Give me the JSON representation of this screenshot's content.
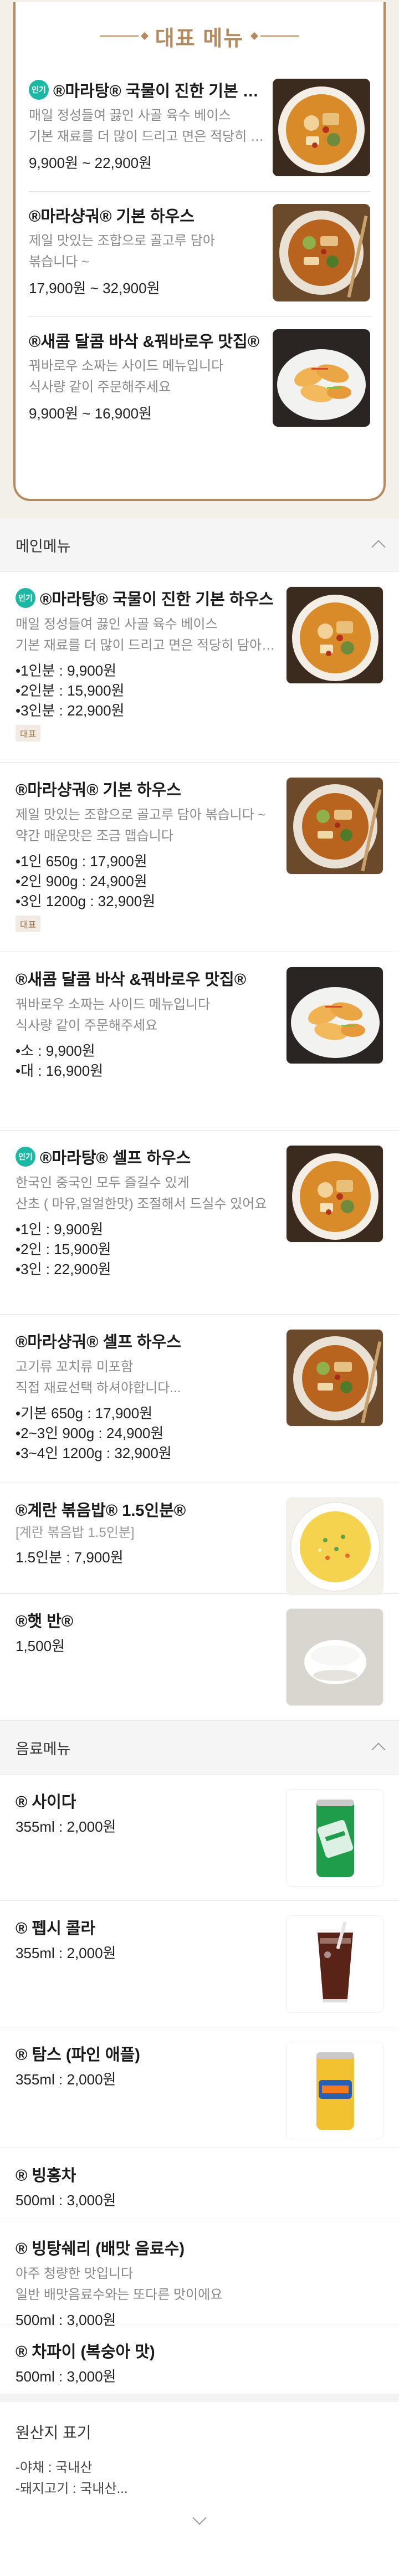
{
  "featured": {
    "title": "대표 메뉴",
    "items": [
      {
        "badge": "인기",
        "name": "®마라탕® 국물이 진한 기본 하우스",
        "desc": [
          "매일 정성들여 끓인 사골 육수 베이스",
          "기본 재료를 더 많이 드리고 면은 적당히 담아드립니다"
        ],
        "price": "9,900원 ~ 22,900원",
        "image": "malatang-bowl"
      },
      {
        "badge": "",
        "name": "®마라샹궈® 기본 하우스",
        "desc": [
          "제일 맛있는 조합으로 골고루 담아",
          "볶습니다 ~"
        ],
        "price": "17,900원 ~ 32,900원",
        "image": "malaxiangguo-plate"
      },
      {
        "badge": "",
        "name": "®새콤 달콤 바삭 &꿔바로우 맛집®",
        "desc": [
          "꿔바로우 소짜는 사이드 메뉴입니다",
          "식사량 같이 주문해주세요"
        ],
        "price": "9,900원 ~ 16,900원",
        "image": "guobaorou-plate"
      }
    ]
  },
  "main_section": {
    "title": "메인메뉴"
  },
  "main_items": [
    {
      "badge": "인기",
      "name": "®마라탕® 국물이 진한 기본 하우스",
      "desc": [
        "매일 정성들여 끓인 사골 육수 베이스",
        "기본 재료를 더 많이 드리고 면은 적당히 담아드립니다"
      ],
      "lines": [
        "•1인분 : 9,900원",
        "•2인분 : 15,900원",
        "•3인분 : 22,900원"
      ],
      "sub": "",
      "tag": "대표",
      "image": "malatang-bowl"
    },
    {
      "badge": "",
      "name": "®마라샹궈® 기본 하우스",
      "desc": [
        "제일 맛있는 조합으로  골고루 담아 볶습니다 ~",
        "약간 매운맛은 조금 맵습니다"
      ],
      "lines": [
        "•1인 650g : 17,900원",
        "•2인 900g : 24,900원",
        "•3인 1200g : 32,900원"
      ],
      "sub": "",
      "tag": "대표",
      "image": "malaxiangguo-plate"
    },
    {
      "badge": "",
      "name": "®새콤 달콤 바삭 &꿔바로우 맛집®",
      "desc": [
        "꿔바로우 소짜는 사이드 메뉴입니다",
        "식사량  같이 주문해주세요"
      ],
      "lines": [
        "•소 : 9,900원",
        "•대 : 16,900원"
      ],
      "sub": "",
      "tag": "",
      "image": "guobaorou-plate"
    },
    {
      "badge": "인기",
      "name": "®마라탕® 셀프 하우스",
      "desc": [
        "한국인 중국인 모두  즐길수 있게",
        "산초 ( 마유,얼얼한맛) 조절해서 드실수 있어요"
      ],
      "lines": [
        "•1인 : 9,900원",
        "•2인 : 15,900원",
        "•3인 : 22,900원"
      ],
      "sub": "",
      "tag": "",
      "image": "malatang-bowl"
    },
    {
      "badge": "",
      "name": "®마라샹궈® 셀프 하우스",
      "desc": [
        "고기류 꼬치류 미포함",
        "직접 재료선택 하셔야합니다..."
      ],
      "lines": [
        "•기본 650g : 17,900원",
        "•2~3인 900g : 24,900원",
        "•3~4인 1200g : 32,900원"
      ],
      "sub": "",
      "tag": "",
      "image": "malaxiangguo-plate"
    },
    {
      "badge": "",
      "name": "®계란 볶음밥® 1.5인분®",
      "desc": [],
      "lines": [
        "1.5인분 : 7,900원"
      ],
      "sub": "[계란 볶음밥 1.5인분]",
      "tag": "",
      "image": "fried-rice"
    },
    {
      "badge": "",
      "name": "®햇 반®",
      "desc": [],
      "lines": [
        "1,500원"
      ],
      "sub": "",
      "tag": "",
      "image": "rice-bowl"
    }
  ],
  "drink_section": {
    "title": "음료메뉴"
  },
  "drink_items": [
    {
      "name": "® 사이다",
      "desc": [],
      "lines": [
        "355ml : 2,000원"
      ],
      "image": "cider-can"
    },
    {
      "name": "® 펩시 콜라",
      "desc": [],
      "lines": [
        "355ml : 2,000원"
      ],
      "image": "cola-glass"
    },
    {
      "name": "® 탐스 (파인 애플)",
      "desc": [],
      "lines": [
        "355ml : 2,000원"
      ],
      "image": "fanta-can"
    },
    {
      "name": "® 빙홍차",
      "desc": [],
      "lines": [
        "500ml : 3,000원"
      ],
      "image": ""
    },
    {
      "name": "® 빙탕쉐리 (배맛 음료수)",
      "desc": [
        "아주 청량한 맛입니다",
        "일반 배맛음료수와는 또다른 맛이에요"
      ],
      "lines": [
        "500ml : 3,000원"
      ],
      "image": ""
    },
    {
      "name": "® 차파이 (복숭아 맛)",
      "desc": [],
      "lines": [
        "500ml : 3,000원"
      ],
      "image": ""
    }
  ],
  "origin": {
    "title": "원산지 표기",
    "lines": [
      "-야채 : 국내산",
      "-돼지고기 : 국내산..."
    ]
  },
  "colors": {
    "accent": "#b48a5e",
    "badge": "#1bb8a5",
    "section_bg": "#f5f5f5"
  }
}
